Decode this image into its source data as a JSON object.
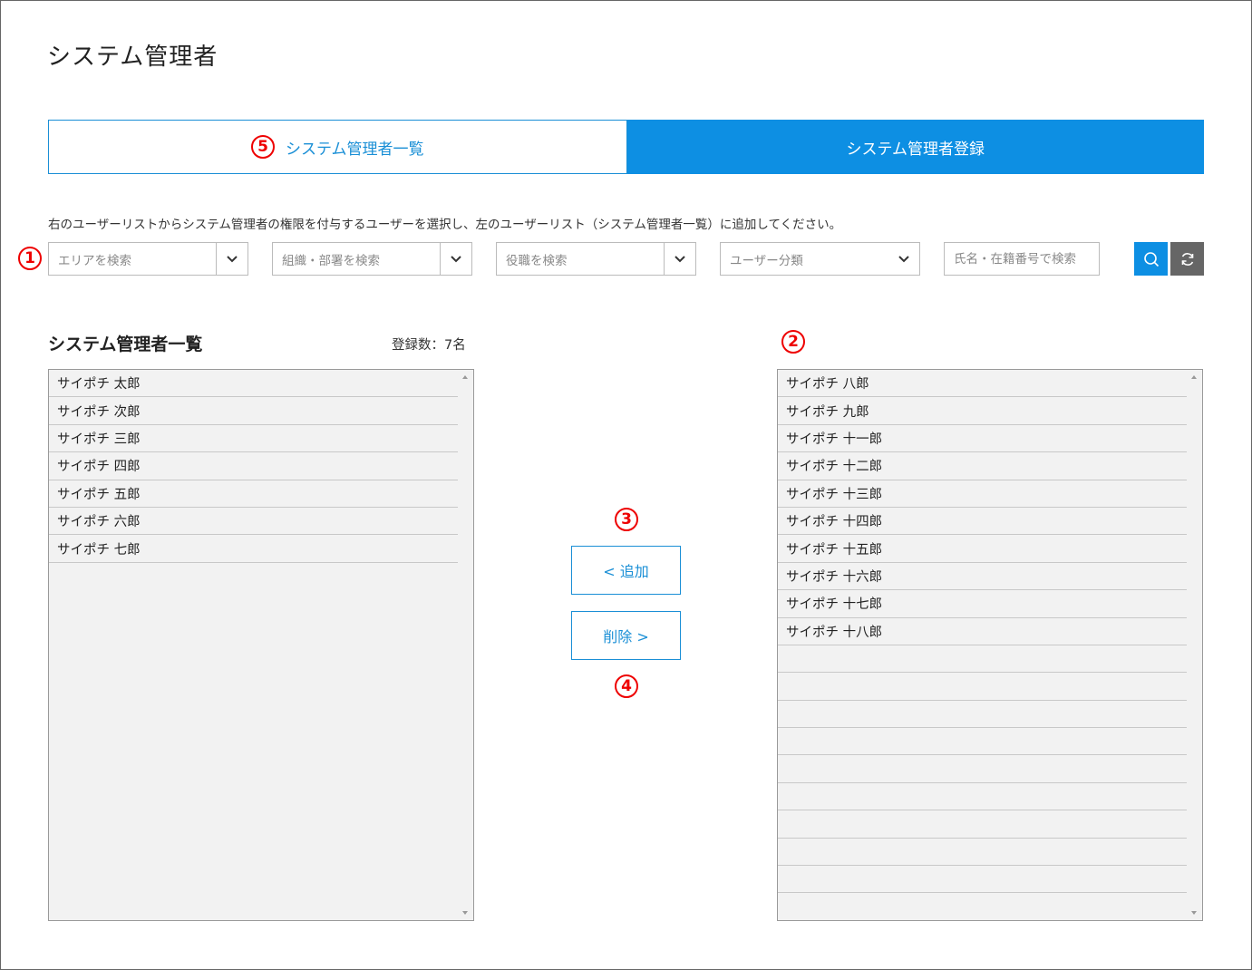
{
  "page": {
    "title": "システム管理者"
  },
  "tabs": [
    {
      "marker": "5",
      "label": "システム管理者一覧"
    },
    {
      "label": "システム管理者登録"
    }
  ],
  "instruction": "右のユーザーリストからシステム管理者の権限を付与するユーザーを選択し、左のユーザーリスト（システム管理者一覧）に追加してください。",
  "filters": {
    "marker": "1",
    "area_placeholder": "エリアを検索",
    "org_placeholder": "組織・部署を検索",
    "role_placeholder": "役職を検索",
    "user_type_placeholder": "ユーザー分類",
    "name_placeholder": "氏名・在籍番号で検索",
    "search_icon": "search-icon",
    "reset_icon": "refresh-icon"
  },
  "admin_list": {
    "title": "システム管理者一覧",
    "count_label": "登録数：7名",
    "items": [
      "サイポチ 太郎",
      "サイポチ 次郎",
      "サイポチ 三郎",
      "サイポチ 四郎",
      "サイポチ 五郎",
      "サイポチ 六郎",
      "サイポチ 七郎"
    ]
  },
  "user_list": {
    "marker": "2",
    "items": [
      "サイポチ 八郎",
      "サイポチ 九郎",
      "サイポチ 十一郎",
      "サイポチ 十二郎",
      "サイポチ 十三郎",
      "サイポチ 十四郎",
      "サイポチ 十五郎",
      "サイポチ 十六郎",
      "サイポチ 十七郎",
      "サイポチ 十八郎"
    ]
  },
  "actions": {
    "add_marker": "3",
    "add_label": "< 追加",
    "delete_label": "削除 >",
    "delete_marker": "4"
  },
  "colors": {
    "accent": "#0d8fe3",
    "marker": "#e00000",
    "list_bg": "#f2f2f2",
    "reset_button": "#666666"
  }
}
